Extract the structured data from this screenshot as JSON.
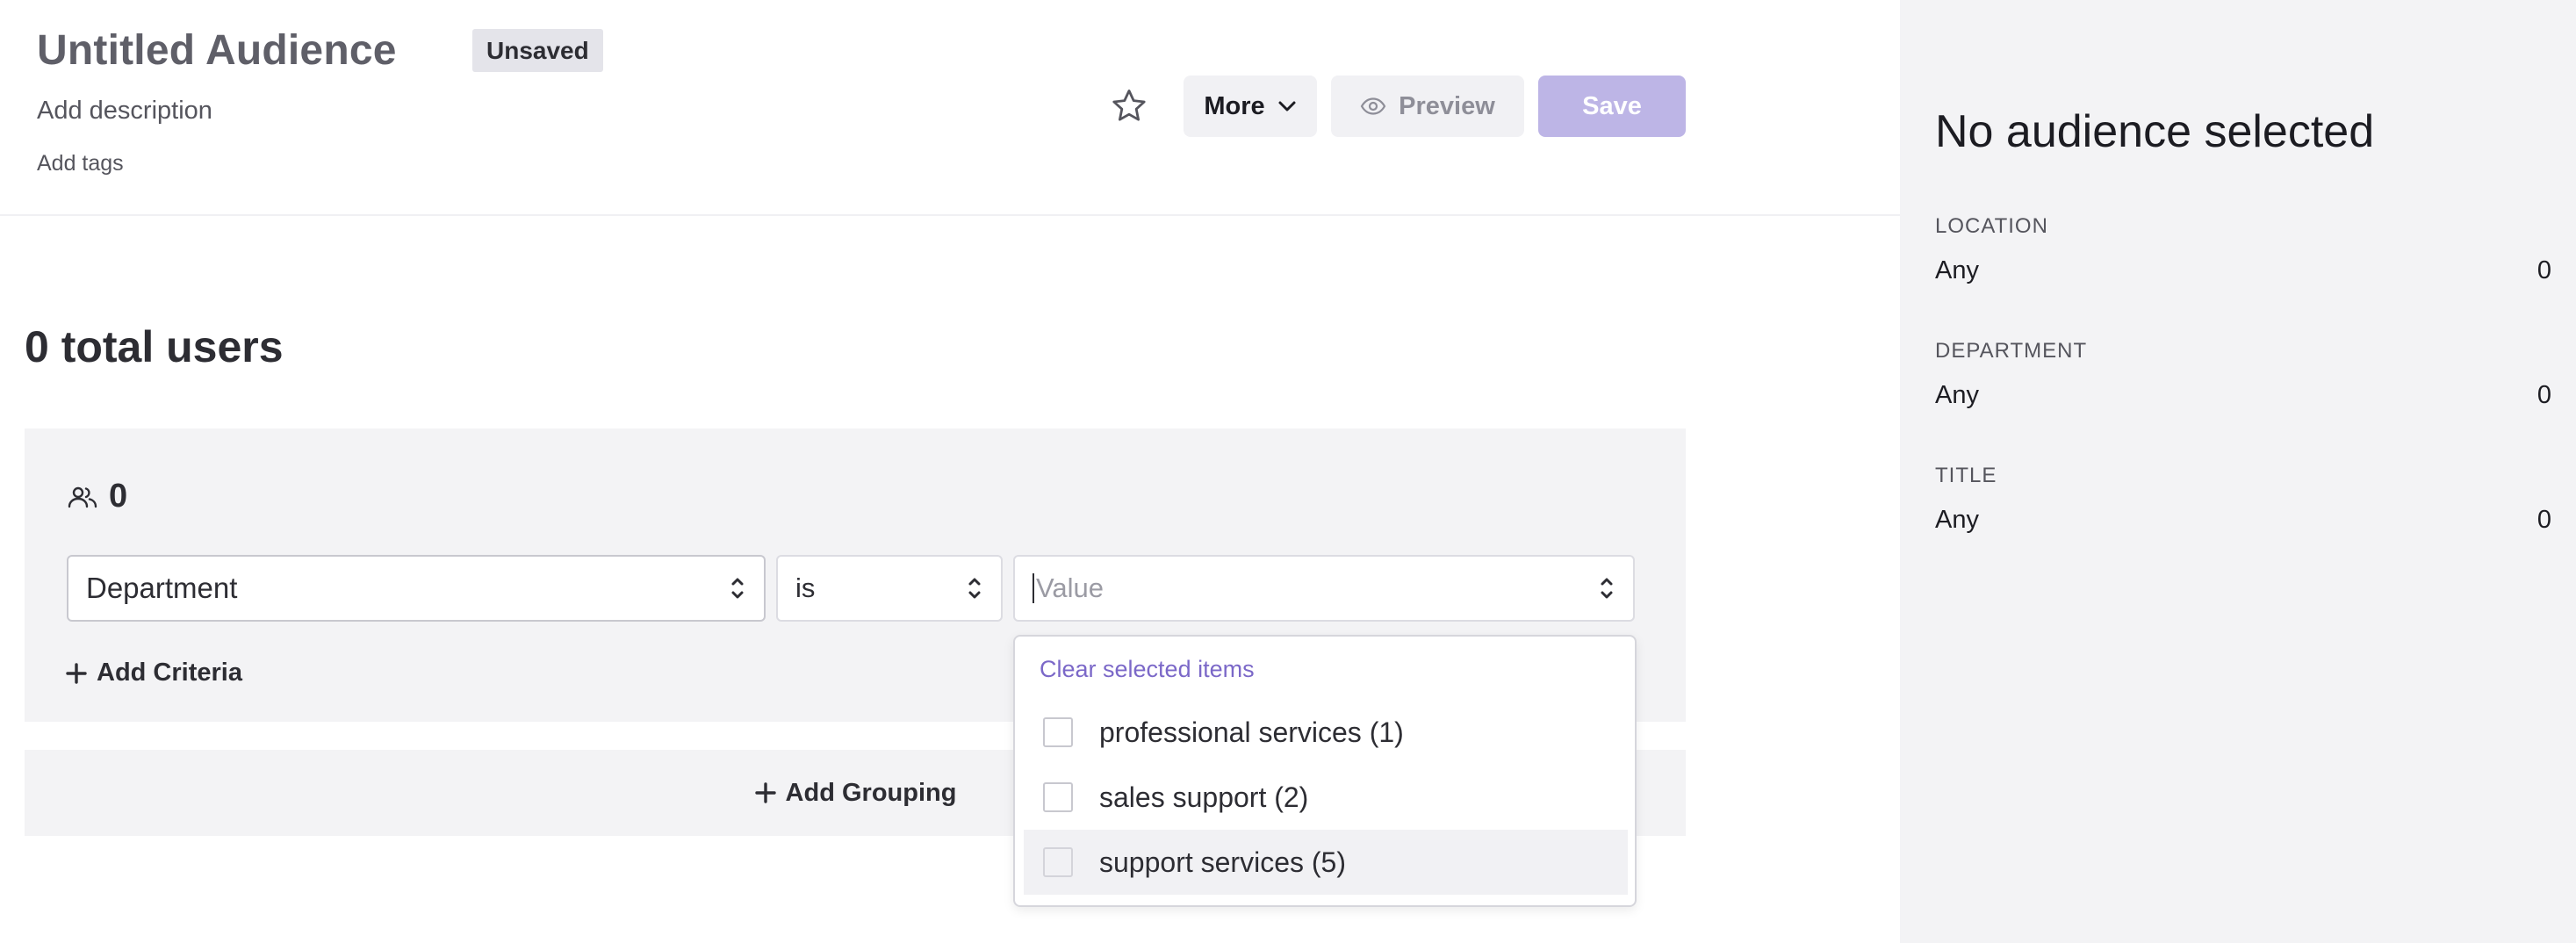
{
  "header": {
    "title": "Untitled Audience",
    "status_badge": "Unsaved",
    "description_placeholder": "Add description",
    "tags_placeholder": "Add tags",
    "more_label": "More",
    "preview_label": "Preview",
    "save_label": "Save"
  },
  "summary": {
    "total_users": "0 total users"
  },
  "group": {
    "count": "0",
    "criteria": {
      "field": "Department",
      "operator": "is",
      "value_placeholder": "Value"
    },
    "add_criteria_label": "Add Criteria"
  },
  "dropdown": {
    "clear_label": "Clear selected items",
    "options": [
      "professional services (1)",
      "sales support (2)",
      "support services (5)"
    ]
  },
  "add_grouping_label": "Add Grouping",
  "side_panel": {
    "title": "No audience selected",
    "sections": [
      {
        "label": "LOCATION",
        "value": "Any",
        "count": "0"
      },
      {
        "label": "DEPARTMENT",
        "value": "Any",
        "count": "0"
      },
      {
        "label": "TITLE",
        "value": "Any",
        "count": "0"
      }
    ]
  },
  "colors": {
    "accent": "#7b68c8",
    "save_button": "#bdb5e6",
    "panel_bg": "#f3f3f5"
  }
}
